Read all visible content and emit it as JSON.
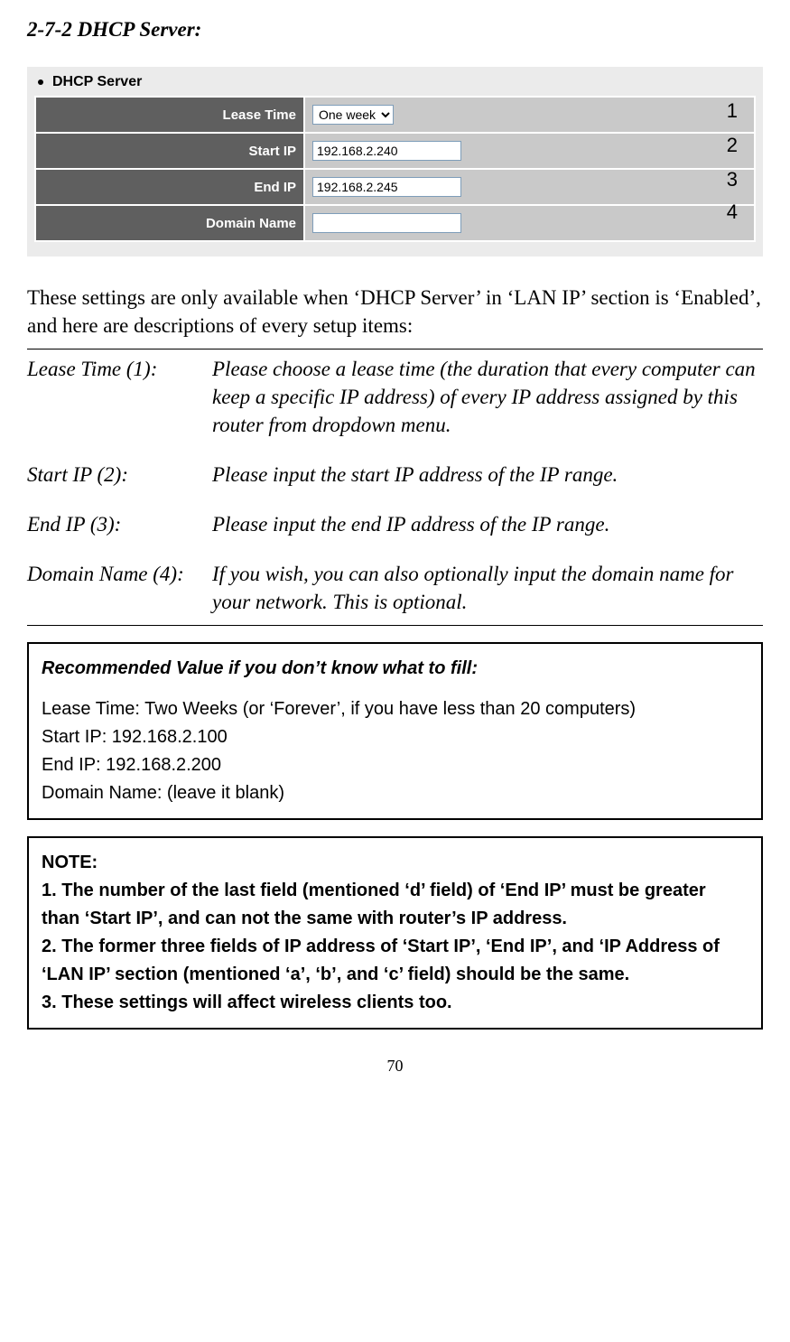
{
  "heading": "2-7-2 DHCP Server:",
  "screenshot": {
    "title": "DHCP Server",
    "rows": [
      {
        "label": "Lease Time",
        "type": "select",
        "value": "One week",
        "num": "1"
      },
      {
        "label": "Start IP",
        "type": "text",
        "value": "192.168.2.240",
        "num": "2"
      },
      {
        "label": "End IP",
        "type": "text",
        "value": "192.168.2.245",
        "num": "3"
      },
      {
        "label": "Domain Name",
        "type": "text",
        "value": "",
        "num": "4"
      }
    ]
  },
  "intro": "These settings are only available when ‘DHCP Server’ in ‘LAN IP’ section is ‘Enabled’, and here are descriptions of every setup items:",
  "defs": [
    {
      "label": "Lease Time (1):",
      "text": "Please choose a lease time (the duration that every computer can keep a specific IP address) of every IP address assigned by this router from dropdown menu."
    },
    {
      "label": "Start IP (2):",
      "text": "Please input the start IP address of the IP range."
    },
    {
      "label": "End IP (3):",
      "text": "Please input the end IP address of the IP range."
    },
    {
      "label": "Domain Name (4):",
      "text": "If you wish, you can also optionally input the domain name for your network. This is optional."
    }
  ],
  "rec_box": {
    "title": "Recommended Value if you don’t know what to fill:",
    "lines": [
      "Lease Time: Two Weeks (or ‘Forever’, if you have less than 20 computers)",
      "Start IP: 192.168.2.100",
      "End IP: 192.168.2.200",
      "Domain Name: (leave it blank)"
    ]
  },
  "note_box": {
    "title": "NOTE:",
    "lines": [
      "1. The number of the last field (mentioned ‘d’ field) of ‘End IP’ must be greater than ‘Start IP’, and can not the same with router’s IP address.",
      "2. The former three fields of IP address of ‘Start IP’, ‘End IP’, and ‘IP Address of ‘LAN IP’ section (mentioned ‘a’, ‘b’, and ‘c’ field) should be the same.",
      "3. These settings will affect wireless clients too."
    ]
  },
  "page_number": "70"
}
